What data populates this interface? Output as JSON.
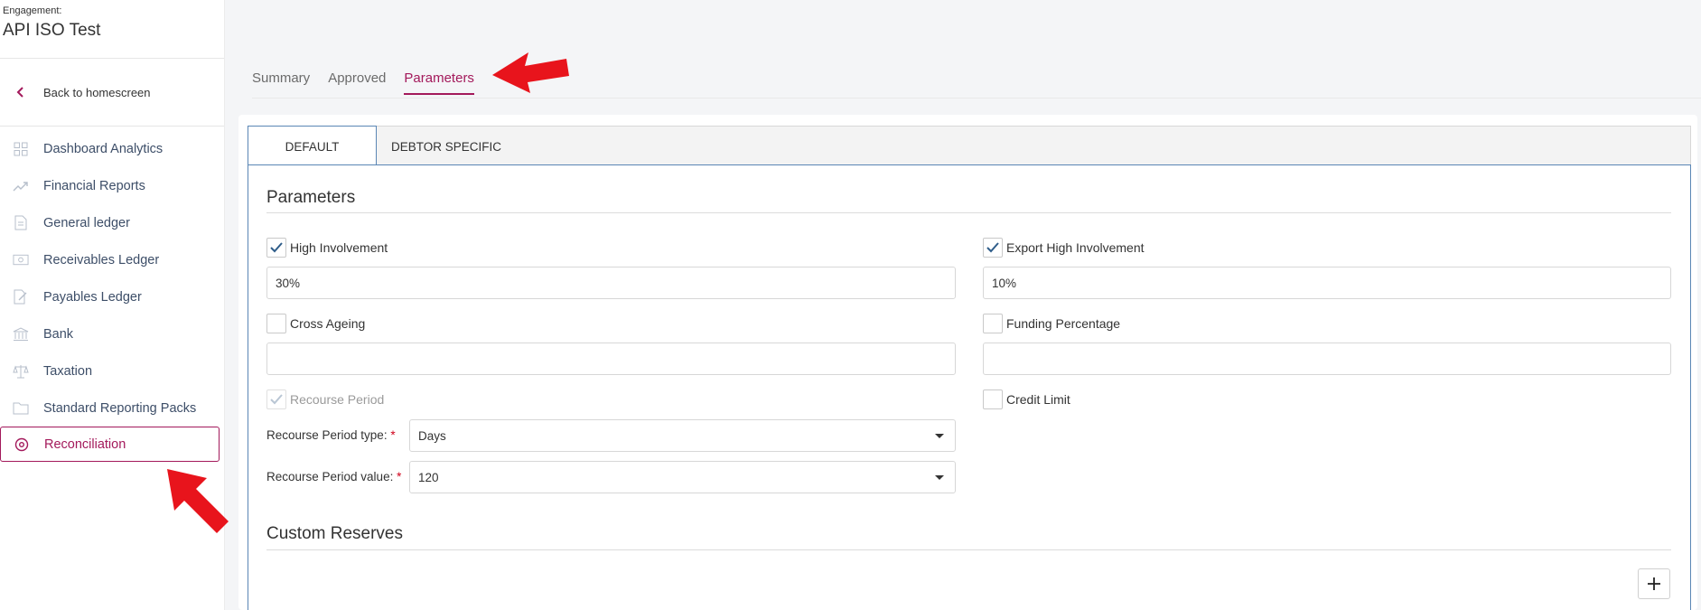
{
  "engagement": {
    "label": "Engagement:",
    "name": "API ISO Test"
  },
  "back": {
    "label": "Back to homescreen"
  },
  "nav": [
    {
      "label": "Dashboard Analytics",
      "icon": "grid-icon"
    },
    {
      "label": "Financial Reports",
      "icon": "trend-icon"
    },
    {
      "label": "General ledger",
      "icon": "document-icon"
    },
    {
      "label": "Receivables Ledger",
      "icon": "cash-icon"
    },
    {
      "label": "Payables Ledger",
      "icon": "edit-document-icon"
    },
    {
      "label": "Bank",
      "icon": "bank-icon"
    },
    {
      "label": "Taxation",
      "icon": "scales-icon"
    },
    {
      "label": "Standard Reporting Packs",
      "icon": "folder-icon"
    },
    {
      "label": "Reconciliation",
      "icon": "target-icon",
      "active": true
    }
  ],
  "tabs": [
    {
      "label": "Summary"
    },
    {
      "label": "Approved"
    },
    {
      "label": "Parameters",
      "active": true
    }
  ],
  "subtabs": [
    {
      "label": "DEFAULT",
      "active": true
    },
    {
      "label": "DEBTOR SPECIFIC"
    }
  ],
  "parameters": {
    "title": "Parameters",
    "high_involvement": {
      "label": "High Involvement",
      "checked": true,
      "value": "30%"
    },
    "export_high_involvement": {
      "label": "Export High Involvement",
      "checked": true,
      "value": "10%"
    },
    "cross_ageing": {
      "label": "Cross Ageing",
      "checked": false,
      "value": ""
    },
    "funding_percentage": {
      "label": "Funding Percentage",
      "checked": false,
      "value": ""
    },
    "recourse_period": {
      "label": "Recourse Period",
      "checked": true,
      "disabled": true
    },
    "credit_limit": {
      "label": "Credit Limit",
      "checked": false
    },
    "recourse_type": {
      "label": "Recourse Period type:",
      "required": "*",
      "value": "Days"
    },
    "recourse_value": {
      "label": "Recourse Period value:",
      "required": "*",
      "value": "120"
    }
  },
  "custom_reserves": {
    "title": "Custom Reserves",
    "add_label": "+"
  },
  "colors": {
    "accent": "#a3195b",
    "tab_border": "#5a86b5",
    "annotation_arrow": "#e8141c"
  }
}
